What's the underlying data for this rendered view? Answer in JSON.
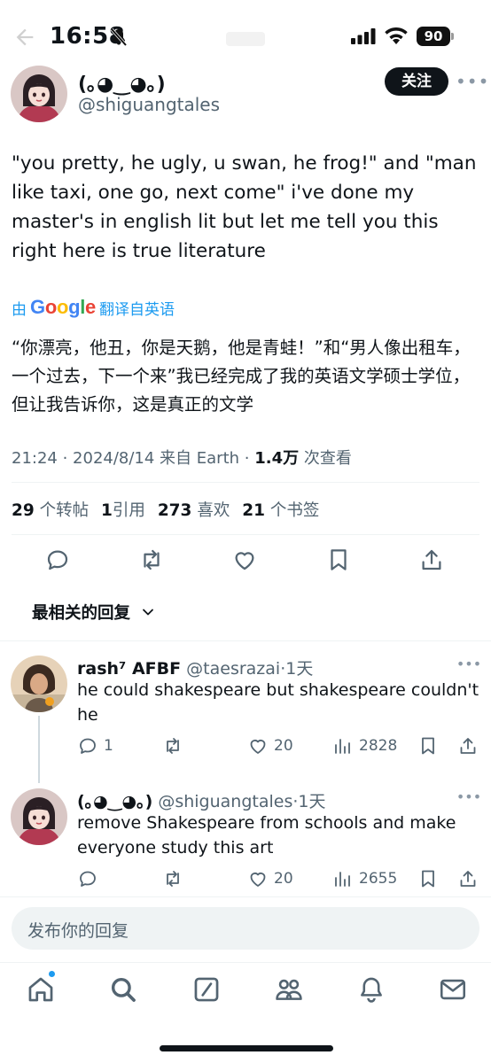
{
  "status_bar": {
    "time": "16:58",
    "battery": "90"
  },
  "main_tweet": {
    "display_name": "(｡◕‿◕｡)",
    "handle": "@shiguangtales",
    "follow_label": "关注",
    "text": "\"you pretty, he ugly, u swan, he frog!\" and \"man like taxi, one go, next come\" i've done my master's in english lit but let me tell you this right here is true literature",
    "translate_prefix": "由",
    "translate_suffix": "翻译自英语",
    "translated_text": "“你漂亮，他丑，你是天鹅，他是青蛙！”和“男人像出租车，一个过去，下一个来”我已经完成了我的英语文学硕士学位，但让我告诉你，这是真正的文学",
    "meta": "21:24 · 2024/8/14 来自 Earth · ",
    "views_count": "1.4万",
    "views_label": " 次查看",
    "stats": {
      "retweets_count": "29",
      "retweets_label": " 个转帖",
      "quotes_count": "1",
      "quotes_label": "引用",
      "likes_count": "273",
      "likes_label": " 喜欢",
      "bookmarks_count": "21",
      "bookmarks_label": " 个书签"
    }
  },
  "sort": {
    "label": "最相关的回复"
  },
  "replies": [
    {
      "name": "rash⁷ AFBF",
      "handle": "@taesrazai",
      "time": "·1天",
      "text": "he could shakespeare but shakespeare couldn't he",
      "reply_count": "1",
      "retweet_count": "",
      "like_count": "20",
      "view_count": "2828"
    },
    {
      "name": "(｡◕‿◕｡)",
      "handle": "@shiguangtales",
      "time": "·1天",
      "text": "remove Shakespeare from schools and make everyone study this art",
      "reply_count": "",
      "retweet_count": "",
      "like_count": "20",
      "view_count": "2655"
    }
  ],
  "composer": {
    "placeholder": "发布你的回复"
  },
  "nav": {
    "items": [
      "home-icon",
      "search-icon",
      "grok-icon",
      "communities-icon",
      "notifications-icon",
      "messages-icon"
    ]
  },
  "colors": {
    "accent": "#1d9bf0",
    "text": "#0f1419",
    "secondary": "#536471"
  }
}
